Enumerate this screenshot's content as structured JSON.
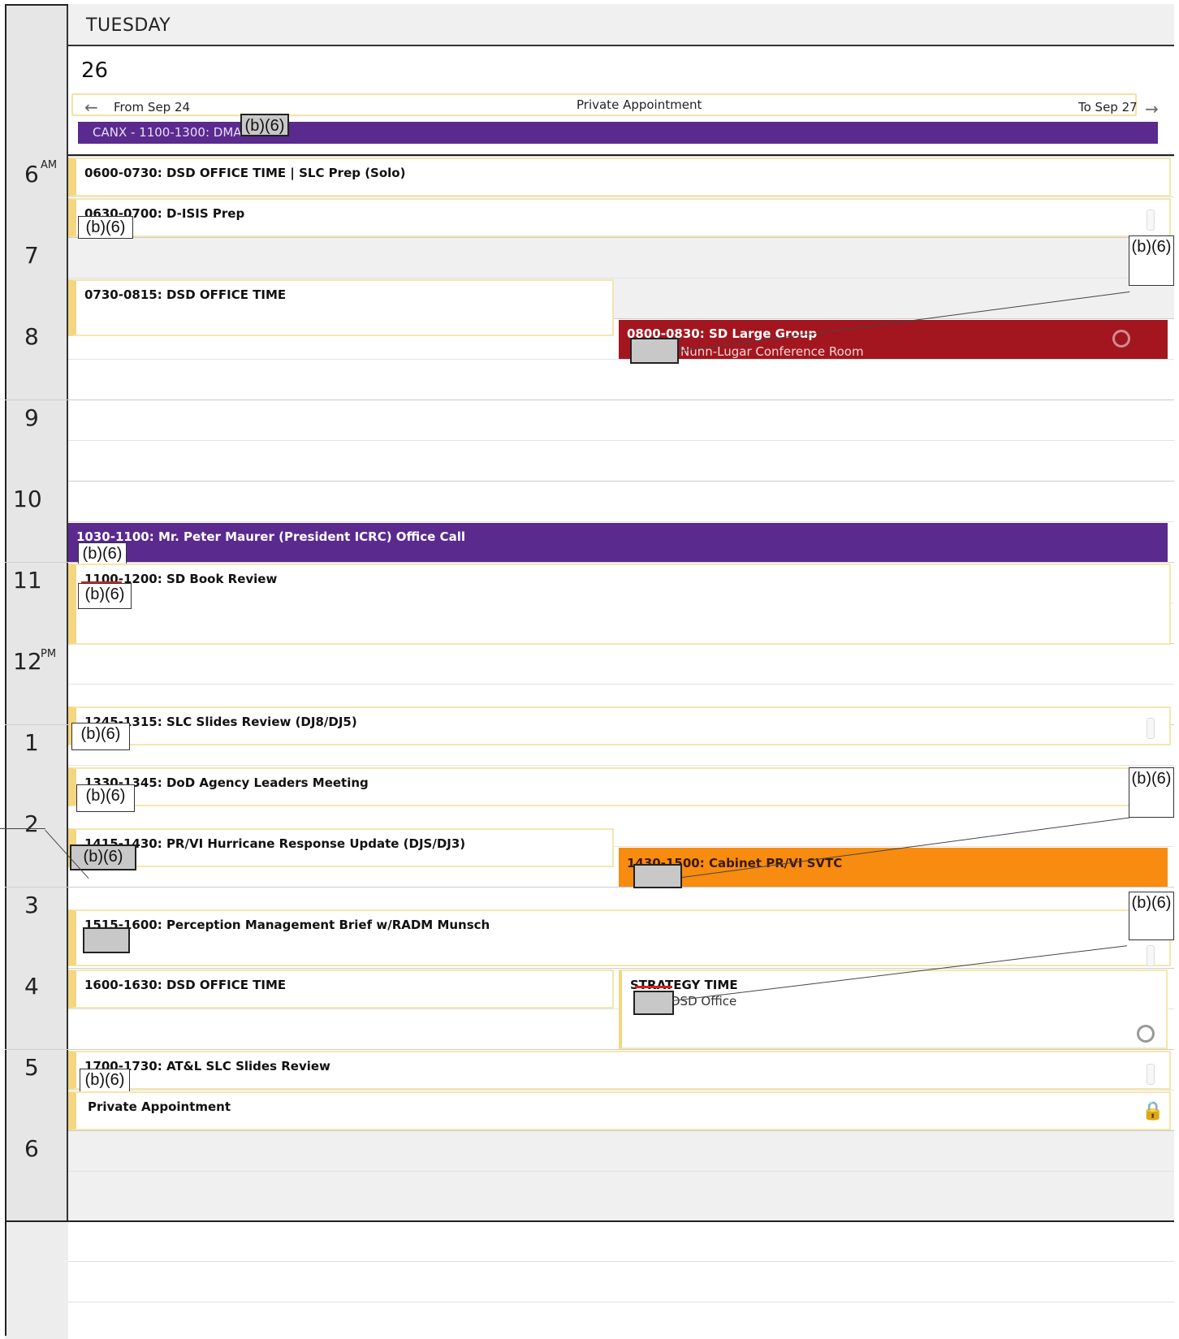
{
  "day": {
    "name": "TUESDAY",
    "date": "26"
  },
  "allday": {
    "from_label": "From Sep 24",
    "to_label": "To Sep 27",
    "private_label": "Private Appointment",
    "canx_label": "CANX - 1100-1300: DMAG"
  },
  "hours": [
    {
      "num": "6",
      "ampm": "AM"
    },
    {
      "num": "7",
      "ampm": ""
    },
    {
      "num": "8",
      "ampm": ""
    },
    {
      "num": "9",
      "ampm": ""
    },
    {
      "num": "10",
      "ampm": ""
    },
    {
      "num": "11",
      "ampm": ""
    },
    {
      "num": "12",
      "ampm": "PM"
    },
    {
      "num": "1",
      "ampm": ""
    },
    {
      "num": "2",
      "ampm": ""
    },
    {
      "num": "3",
      "ampm": ""
    },
    {
      "num": "4",
      "ampm": ""
    },
    {
      "num": "5",
      "ampm": ""
    },
    {
      "num": "6",
      "ampm": ""
    }
  ],
  "events": {
    "e0600": {
      "title": "0600-0730: DSD OFFICE TIME | SLC Prep (Solo)"
    },
    "e0630": {
      "title": "0630-0700: D-ISIS Prep"
    },
    "e0730": {
      "title": "0730-0815: DSD OFFICE TIME"
    },
    "e0800": {
      "title": "0800-0830: SD Large Group",
      "location": "Nunn-Lugar Conference Room"
    },
    "e1030": {
      "title": "1030-1100: Mr. Peter Maurer (President ICRC) Office Call"
    },
    "e1100": {
      "title": "1100-1200: SD Book Review"
    },
    "e1245": {
      "title": "1245-1315: SLC Slides Review (DJ8/DJ5)"
    },
    "e1330": {
      "title": "1330-1345: DoD Agency Leaders Meeting"
    },
    "e1415": {
      "title": "1415-1430: PR/VI Hurricane Response Update (DJS/DJ3)"
    },
    "e1430": {
      "title": "1430-1500: Cabinet PR/VI SVTC"
    },
    "e1515": {
      "title": "1515-1600: Perception Management Brief w/RADM Munsch"
    },
    "e1600": {
      "title": "1600-1630: DSD OFFICE TIME"
    },
    "estrat": {
      "title": "STRATEGY TIME",
      "location": "DSD Office"
    },
    "e1700": {
      "title": "1700-1730: AT&L SLC Slides Review"
    },
    "epriv": {
      "title": "Private Appointment"
    }
  },
  "redaction_label": "(b)(6)",
  "colors": {
    "purple": "#5a2a8e",
    "red": "#a3161f",
    "orange": "#f88c10",
    "event_border": "#f4e6ae",
    "event_accent": "#f3d67f"
  },
  "icons": [
    "arrow-left-icon",
    "arrow-right-icon",
    "recurring-icon",
    "lock-icon",
    "reminder-icon"
  ]
}
